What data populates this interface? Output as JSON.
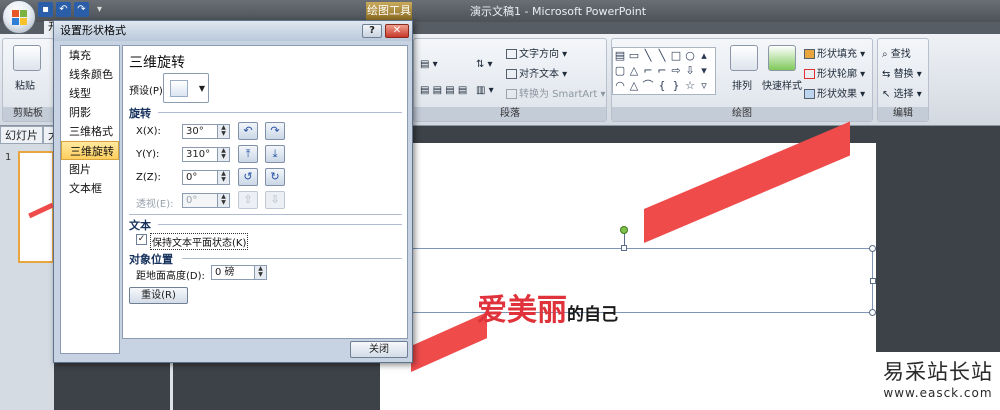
{
  "window": {
    "title": "演示文稿1 - Microsoft PowerPoint",
    "context_tab": "绘图工具"
  },
  "ribbon": {
    "tab_partial": "开",
    "clipboard": {
      "paste": "粘贴",
      "group": "剪贴板"
    },
    "paragraph": {
      "text_direction": "文字方向",
      "align_text": "对齐文本",
      "convert_smartart": "转换为 SmartArt",
      "group": "段落"
    },
    "drawing": {
      "arrange": "排列",
      "quick_styles": "快速样式",
      "shape_fill": "形状填充",
      "shape_outline": "形状轮廓",
      "shape_effects": "形状效果",
      "group": "绘图"
    },
    "editing": {
      "find": "查找",
      "replace": "替换",
      "select": "选择",
      "group": "编辑"
    }
  },
  "slides_panel": {
    "tab_slides": "幻灯片",
    "tab_outline": "大",
    "slide_number": "1"
  },
  "slide": {
    "text_red": "爱美丽",
    "text_black": "的自己"
  },
  "dialog": {
    "title": "设置形状格式",
    "help": "?",
    "close_x": "✕",
    "nav": [
      "填充",
      "线条颜色",
      "线型",
      "阴影",
      "三维格式",
      "三维旋转",
      "图片",
      "文本框"
    ],
    "nav_selected": "三维旋转",
    "heading": "三维旋转",
    "preset_label": "预设(P):",
    "rotation_header": "旋转",
    "x_label": "X(X):",
    "x_value": "30°",
    "y_label": "Y(Y):",
    "y_value": "310°",
    "z_label": "Z(Z):",
    "z_value": "0°",
    "perspective_label": "透视(E):",
    "perspective_value": "0°",
    "text_header": "文本",
    "keep_flat_label": "保持文本平面状态(K)",
    "keep_flat_checked": true,
    "position_header": "对象位置",
    "distance_label": "距地面高度(D):",
    "distance_value": "0 磅",
    "reset_label": "重设(R)",
    "close_label": "关闭"
  },
  "watermark": {
    "cn": "易采站长站",
    "url": "www.easck.com"
  }
}
